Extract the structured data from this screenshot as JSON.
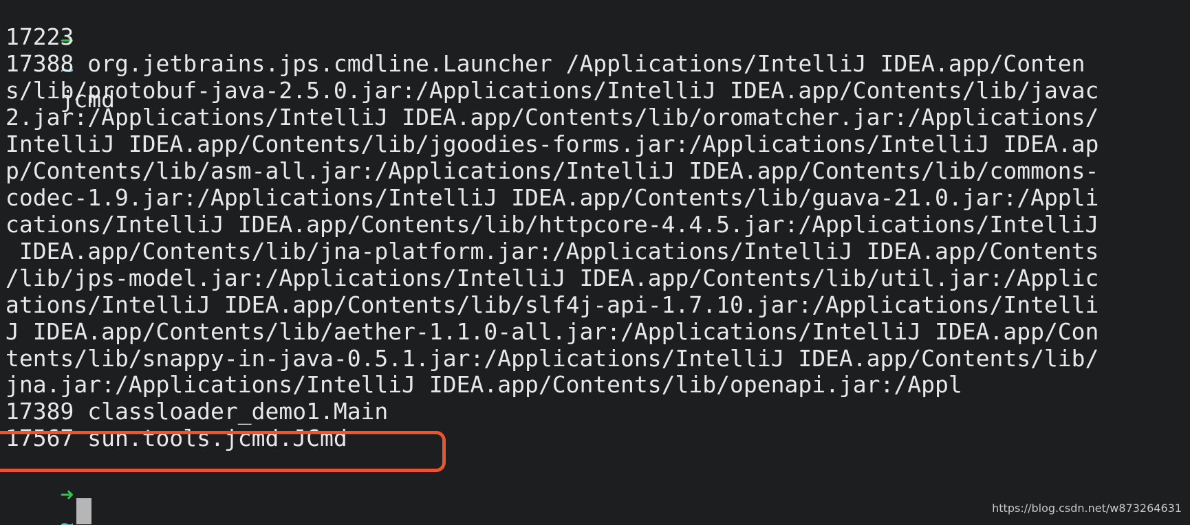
{
  "terminal": {
    "prompt_arrow": "➜",
    "prompt_dir": "~",
    "command": "jcmd",
    "output": [
      "17223",
      "17388 org.jetbrains.jps.cmdline.Launcher /Applications/IntelliJ IDEA.app/Conten",
      "s/lib/protobuf-java-2.5.0.jar:/Applications/IntelliJ IDEA.app/Contents/lib/javac",
      "2.jar:/Applications/IntelliJ IDEA.app/Contents/lib/oromatcher.jar:/Applications/",
      "IntelliJ IDEA.app/Contents/lib/jgoodies-forms.jar:/Applications/IntelliJ IDEA.ap",
      "p/Contents/lib/asm-all.jar:/Applications/IntelliJ IDEA.app/Contents/lib/commons-",
      "codec-1.9.jar:/Applications/IntelliJ IDEA.app/Contents/lib/guava-21.0.jar:/Appli",
      "cations/IntelliJ IDEA.app/Contents/lib/httpcore-4.4.5.jar:/Applications/IntelliJ",
      " IDEA.app/Contents/lib/jna-platform.jar:/Applications/IntelliJ IDEA.app/Contents",
      "/lib/jps-model.jar:/Applications/IntelliJ IDEA.app/Contents/lib/util.jar:/Applic",
      "ations/IntelliJ IDEA.app/Contents/lib/slf4j-api-1.7.10.jar:/Applications/Intelli",
      "J IDEA.app/Contents/lib/aether-1.1.0-all.jar:/Applications/IntelliJ IDEA.app/Con",
      "tents/lib/snappy-in-java-0.5.1.jar:/Applications/IntelliJ IDEA.app/Contents/lib/",
      "jna.jar:/Applications/IntelliJ IDEA.app/Contents/lib/openapi.jar:/Appl",
      "17389 classloader_demo1.Main",
      "17567 sun.tools.jcmd.JCmd"
    ]
  },
  "watermark": "https://blog.csdn.net/w873264631",
  "colors": {
    "background": "#1d1e20",
    "text": "#e8e8e8",
    "prompt_arrow": "#35c04c",
    "prompt_dir": "#5fc5d6",
    "highlight": "#e8552f",
    "cursor": "#b6b6b6"
  }
}
